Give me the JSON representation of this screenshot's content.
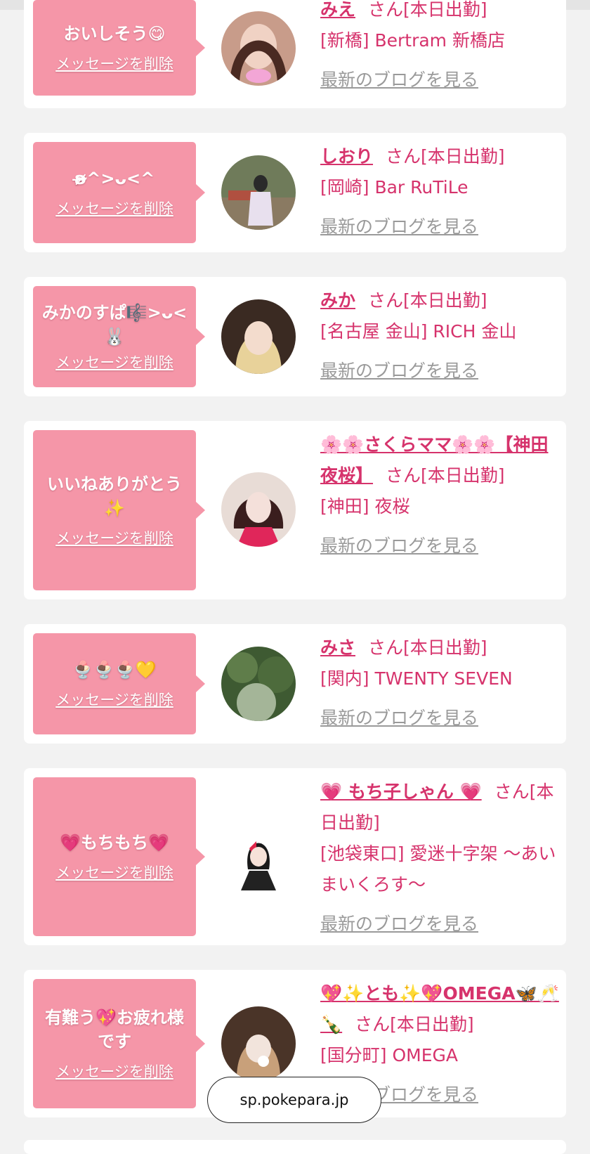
{
  "san_label": "さん",
  "shift_label": "[本日出勤]",
  "delete_label": "メッセージを削除",
  "blog_label": "最新のブログを見る",
  "url": "sp.pokepara.jp",
  "cards": [
    {
      "message": "おいしそう😋",
      "name": "みえ",
      "area": "[新橋] Bertram 新橋店"
    },
    {
      "message": "ʚ̴̶̷̷^>ᴗ<^",
      "name": "しおり",
      "area": "[岡崎] Bar RuTiLe"
    },
    {
      "message": "みかのすぱ🎼>ᴗ<🐰",
      "name": "みか",
      "area": "[名古屋 金山] RICH 金山"
    },
    {
      "message": "いいねありがとう✨",
      "name": "🌸🌸さくらママ🌸🌸【神田夜桜】",
      "area": "[神田] 夜桜"
    },
    {
      "message": "🍨🍨🍨💛",
      "name": "みさ",
      "area": "[関内] TWENTY SEVEN"
    },
    {
      "message": "💗もちもち💗",
      "name": "💗 もち子しゃん 💗",
      "area": "[池袋東口] 愛迷十字架 〜あいまいくろす〜"
    },
    {
      "message": "有難う💖お疲れ様です",
      "name": "💖✨とも✨💖OMEGA🦋🥂🍾",
      "area": "[国分町] OMEGA"
    }
  ]
}
